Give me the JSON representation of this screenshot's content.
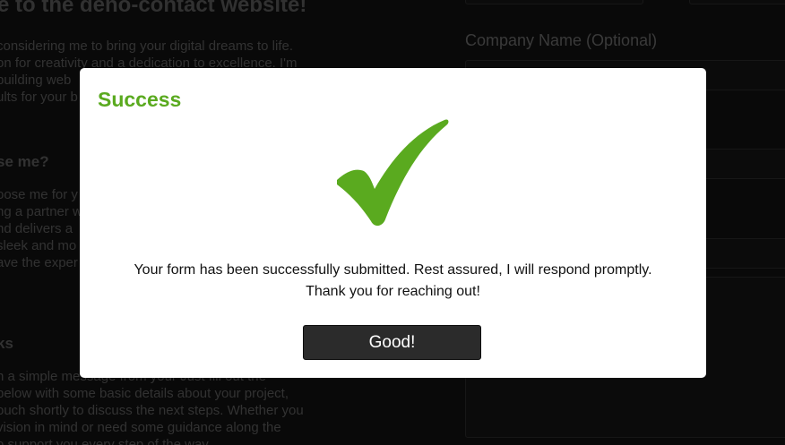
{
  "page": {
    "heading": "e to the deno-contact website!",
    "intro_lines": [
      "considering me to bring your digital dreams to life.",
      "on for creativity and a dedication to excellence. I'm",
      "building web",
      "ults for your b"
    ],
    "choose_heading": "se me?",
    "choose_lines": [
      "oose me for y",
      "ng a partner w",
      "nd delivers a",
      "sleek and mo",
      "ave the exper"
    ],
    "works_heading": "ks",
    "works_lines": [
      "n a simple message from your Just fill out the",
      "below with some basic details about your project,",
      "ouch shortly to discuss the next steps. Whether you",
      "vision in mind or need some guidance along the",
      "o support you every step of the way."
    ]
  },
  "form": {
    "company_label": "Company Name (Optional)"
  },
  "modal": {
    "title": "Success",
    "icon": "checkmark-icon",
    "message_line1": "Your form has been successfully submitted. Rest assured, I will respond promptly.",
    "message_line2": "Thank you for reaching out!",
    "button_label": "Good!"
  },
  "colors": {
    "success": "#5aaa1f",
    "button_bg": "#2b2b2b",
    "page_bg": "#111111"
  }
}
